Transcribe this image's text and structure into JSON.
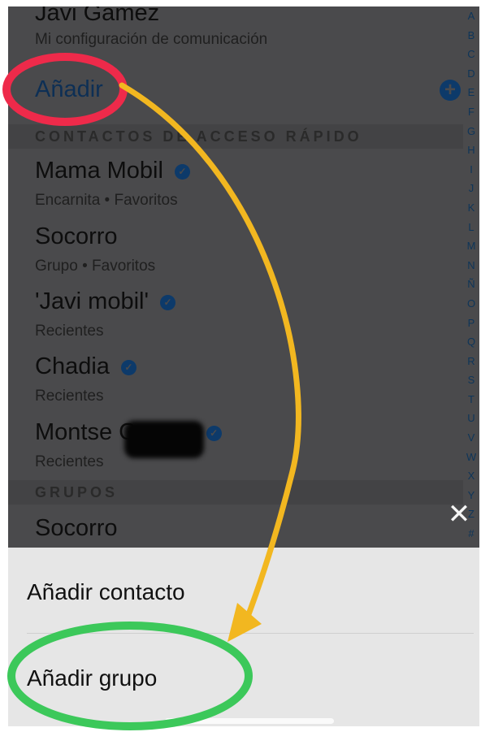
{
  "header": {
    "top_name": "Javi Gamez",
    "top_sub": "Mi configuración de comunicación",
    "add_label": "Añadir"
  },
  "sections": {
    "quick_access": "CONTACTOS DE ACCESO RÁPIDO",
    "groups": "GRUPOS"
  },
  "contacts": [
    {
      "name": "Mama Mobil",
      "sub": "Encarnita • Favoritos",
      "verified": true
    },
    {
      "name": "Socorro",
      "sub": "Grupo • Favoritos",
      "verified": false
    },
    {
      "name": "'Javi mobil'",
      "sub": "Recientes",
      "verified": true
    },
    {
      "name": "Chadia",
      "sub": "Recientes",
      "verified": true
    },
    {
      "name": "Montse Gamez",
      "sub": "Recientes",
      "verified": true
    }
  ],
  "groups": [
    {
      "name": "Socorro"
    }
  ],
  "index_letters": [
    "A",
    "B",
    "C",
    "D",
    "E",
    "F",
    "G",
    "H",
    "I",
    "J",
    "K",
    "L",
    "M",
    "N",
    "Ñ",
    "O",
    "P",
    "Q",
    "R",
    "S",
    "T",
    "U",
    "V",
    "W",
    "X",
    "Y",
    "Z",
    "#"
  ],
  "sheet": {
    "add_contact": "Añadir contacto",
    "add_group": "Añadir grupo"
  },
  "icons": {
    "close": "close-icon",
    "add": "plus-circle-icon",
    "verified": "verified-check-icon"
  },
  "colors": {
    "overlay": "#4a4a4c",
    "link": "#0d2f55",
    "annotation_red": "#ee2a4a",
    "annotation_yellow": "#f2b720",
    "annotation_green": "#3cc85a"
  }
}
